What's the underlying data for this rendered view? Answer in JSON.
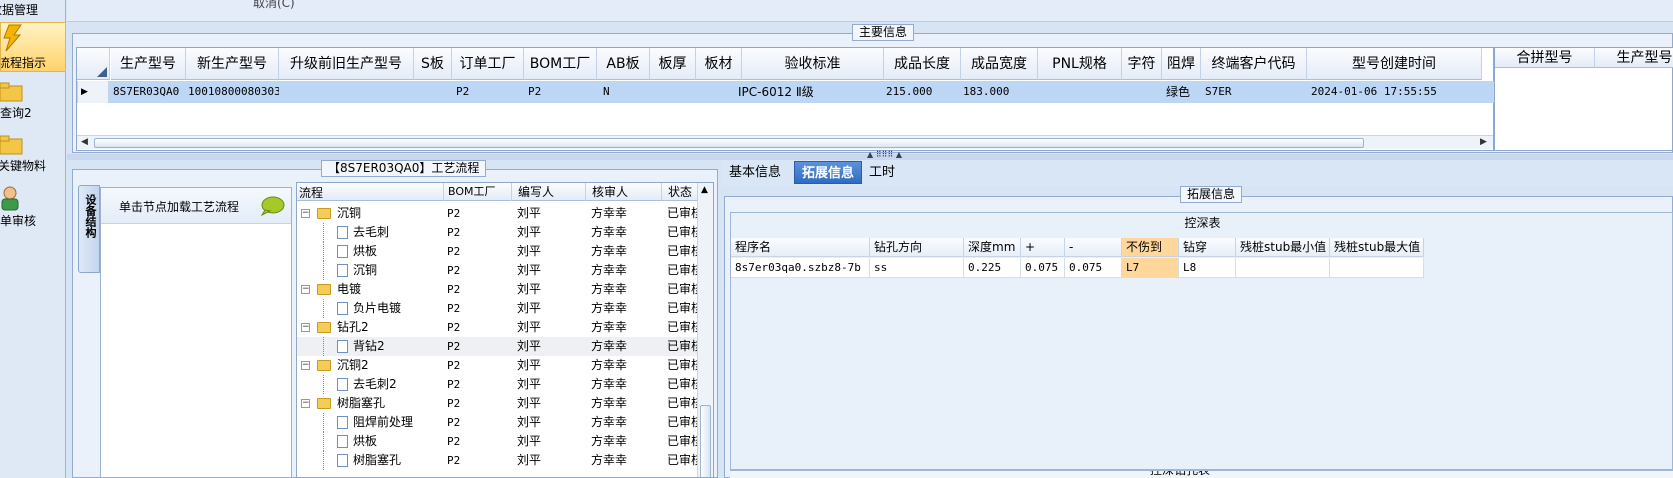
{
  "left_nav": {
    "items": [
      {
        "label": "数据管理"
      },
      {
        "label": "流程指示"
      },
      {
        "label": "查询2"
      },
      {
        "label": "关键物料"
      },
      {
        "label": "单审核"
      }
    ]
  },
  "top_strip_text": "取消(C)",
  "main_info": {
    "title": "主要信息",
    "columns": [
      "生产型号",
      "新生产型号",
      "升级前旧生产型号",
      "S板",
      "订单工厂",
      "BOM工厂",
      "AB板",
      "板厚",
      "板材",
      "验收标准",
      "成品长度",
      "成品宽度",
      "PNL规格",
      "字符",
      "阻焊",
      "终端客户代码",
      "型号创建时间"
    ],
    "row": {
      "marker": "▶",
      "cells": [
        "8S7ER03QA0",
        "10010800080303",
        "",
        "",
        "P2",
        "P2",
        "N",
        "",
        "",
        "IPC-6012 Ⅱ级",
        "215.000",
        "183.000",
        "",
        "",
        "绿色",
        "S7ER",
        "2024-01-06 17:55:55"
      ]
    },
    "side_columns": [
      "合拼型号",
      "生产型号"
    ]
  },
  "process": {
    "title": "【8S7ER03QA0】工艺流程",
    "vertical_tab": "设备结构",
    "hint": "单击节点加载工艺流程",
    "columns": [
      "流程",
      "BOM工厂",
      "编写人",
      "核审人",
      "状态"
    ],
    "rows": [
      {
        "level": 1,
        "type": "folder",
        "name": "沉铜",
        "bom": "P2",
        "author": "刘平",
        "reviewer": "方幸幸",
        "status": "已审核"
      },
      {
        "level": 2,
        "type": "doc",
        "name": "去毛刺",
        "bom": "P2",
        "author": "刘平",
        "reviewer": "方幸幸",
        "status": "已审核"
      },
      {
        "level": 2,
        "type": "doc",
        "name": "烘板",
        "bom": "P2",
        "author": "刘平",
        "reviewer": "方幸幸",
        "status": "已审核"
      },
      {
        "level": 2,
        "type": "doc",
        "name": "沉铜",
        "bom": "P2",
        "author": "刘平",
        "reviewer": "方幸幸",
        "status": "已审核"
      },
      {
        "level": 1,
        "type": "folder",
        "name": "电镀",
        "bom": "P2",
        "author": "刘平",
        "reviewer": "方幸幸",
        "status": "已审核"
      },
      {
        "level": 2,
        "type": "doc",
        "name": "负片电镀",
        "bom": "P2",
        "author": "刘平",
        "reviewer": "方幸幸",
        "status": "已审核"
      },
      {
        "level": 1,
        "type": "folder",
        "name": "钻孔2",
        "bom": "P2",
        "author": "刘平",
        "reviewer": "方幸幸",
        "status": "已审核"
      },
      {
        "level": 2,
        "type": "doc",
        "name": "背钻2",
        "bom": "P2",
        "author": "刘平",
        "reviewer": "方幸幸",
        "status": "已审核",
        "selected": true
      },
      {
        "level": 1,
        "type": "folder",
        "name": "沉铜2",
        "bom": "P2",
        "author": "刘平",
        "reviewer": "方幸幸",
        "status": "已审核"
      },
      {
        "level": 2,
        "type": "doc",
        "name": "去毛刺2",
        "bom": "P2",
        "author": "刘平",
        "reviewer": "方幸幸",
        "status": "已审核"
      },
      {
        "level": 1,
        "type": "folder",
        "name": "树脂塞孔",
        "bom": "P2",
        "author": "刘平",
        "reviewer": "方幸幸",
        "status": "已审核"
      },
      {
        "level": 2,
        "type": "doc",
        "name": "阻焊前处理",
        "bom": "P2",
        "author": "刘平",
        "reviewer": "方幸幸",
        "status": "已审核"
      },
      {
        "level": 2,
        "type": "doc",
        "name": "烘板",
        "bom": "P2",
        "author": "刘平",
        "reviewer": "方幸幸",
        "status": "已审核"
      },
      {
        "level": 2,
        "type": "doc",
        "name": "树脂塞孔",
        "bom": "P2",
        "author": "刘平",
        "reviewer": "方幸幸",
        "status": "已审核"
      }
    ]
  },
  "right_panel": {
    "tabs": [
      {
        "label": "基本信息"
      },
      {
        "label": "拓展信息"
      },
      {
        "label": "工时"
      }
    ],
    "active_tab": 1,
    "group_title": "拓展信息",
    "table_title": "控深表",
    "columns": [
      "程序名",
      "钻孔方向",
      "深度mm",
      "+",
      "-",
      "不伤到",
      "钻穿",
      "残桩stub最小值",
      "残桩stub最大值"
    ],
    "rows": [
      [
        "8s7er03qa0.szbz8-7b",
        "ss",
        "0.225",
        "0.075",
        "0.075",
        "L7",
        "L8",
        "",
        ""
      ]
    ],
    "bottom_cut": "控深钻孔表"
  }
}
